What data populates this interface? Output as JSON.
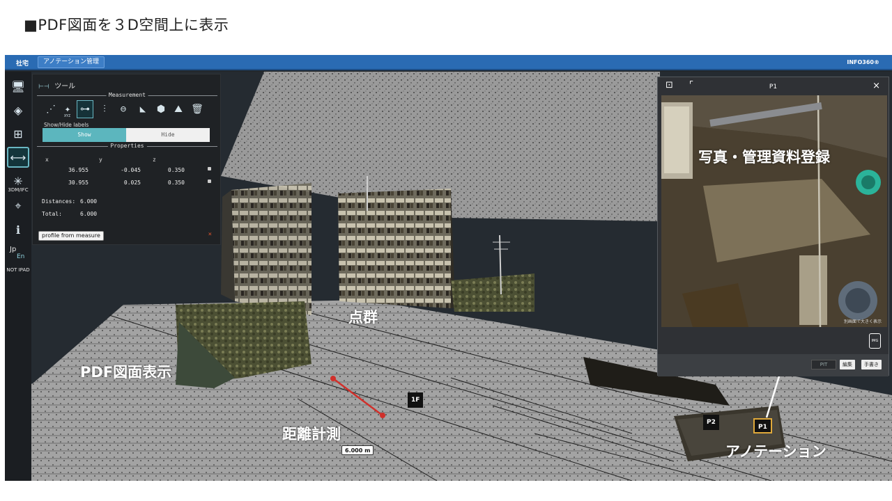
{
  "slide_title": "■PDF図面を３D空間上に表示",
  "topbar": {
    "home": "社宅",
    "tab": "アノテーション管理",
    "brand": "INFO360®"
  },
  "leftbar": {
    "label_3dm": "3DM/IFC",
    "lang_jp": "Jp",
    "lang_en": "En",
    "not_ipad": "NOT IPAD"
  },
  "tool_panel": {
    "title": "ツール",
    "measurement_section": "Measurement",
    "show_hide_label": "Show/Hide labels",
    "show": "Show",
    "hide": "Hide",
    "properties_section": "Properties",
    "columns": [
      "x",
      "y",
      "z"
    ],
    "rows": [
      {
        "x": "36.955",
        "y": "-0.045",
        "z": "0.350"
      },
      {
        "x": "30.955",
        "y": "0.025",
        "z": "0.350"
      }
    ],
    "distances_label": "Distances:",
    "distances_value": "6.000",
    "total_label": "Total:",
    "total_value": "6.000",
    "profile_button": "profile from measure",
    "close_glyph": "×",
    "xyz_tag": "XYZ"
  },
  "photo_panel": {
    "title": "P1",
    "close_glyph": "×",
    "img_label": "IMG",
    "pit": "PIT",
    "edit_button": "編集",
    "handwrite_button": "手書き",
    "caption": "別画面で大きく表示"
  },
  "markers": {
    "one_f": "1F",
    "p1": "P1",
    "p2": "P2",
    "distance": "6.000 m"
  },
  "callouts": {
    "photo": "写真・管理資料登録",
    "pointcloud": "点群",
    "pdf": "PDF図面表示",
    "distance": "距離計測",
    "annotation": "アノテーション"
  },
  "colors": {
    "topbar": "#2a6bb3",
    "accent": "#5cb6be",
    "measure_line": "#d0302b",
    "p1_border": "#e0a93a"
  }
}
